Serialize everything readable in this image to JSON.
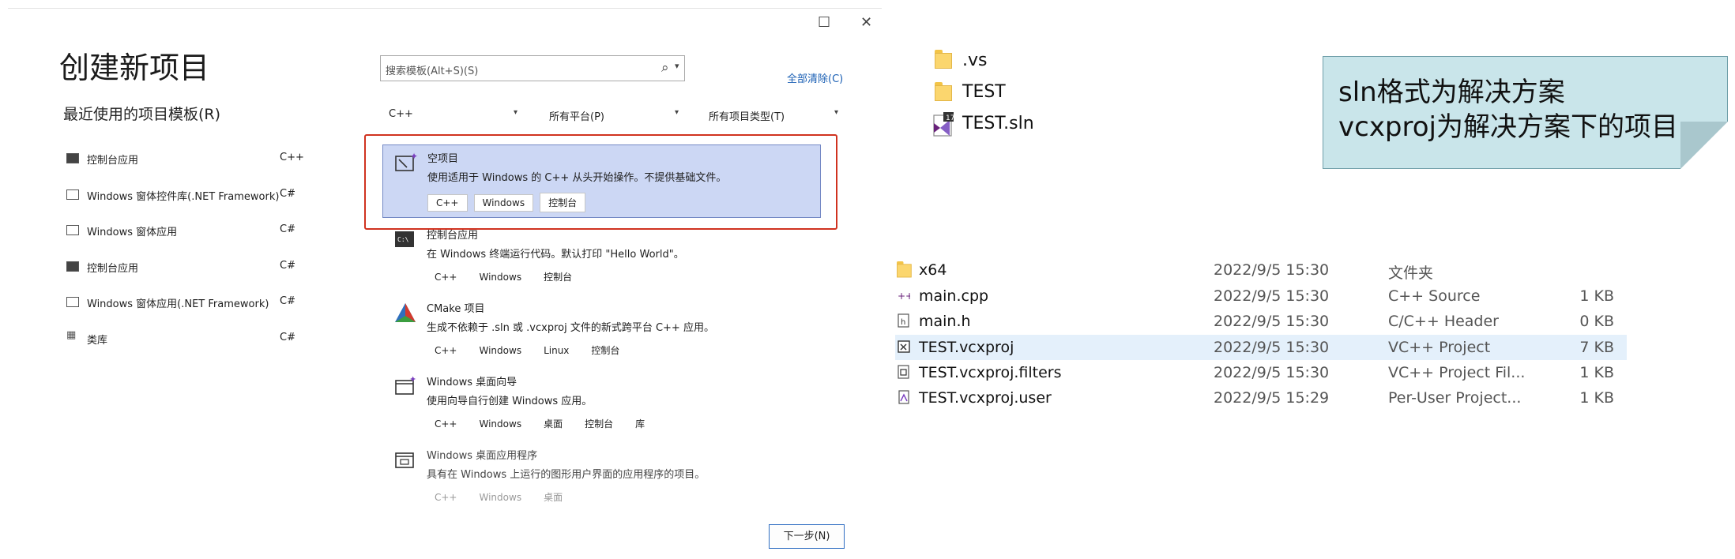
{
  "dialog": {
    "window_controls": {
      "maximize": "☐",
      "close": "✕"
    },
    "title": "创建新项目",
    "recent_heading": "最近使用的项目模板(R)",
    "recent_items": [
      {
        "label": "控制台应用",
        "lang": "C++",
        "icon": "console-icon"
      },
      {
        "label": "Windows 窗体控件库(.NET Framework)",
        "lang": "C#",
        "icon": "winforms-icon"
      },
      {
        "label": "Windows 窗体应用",
        "lang": "C#",
        "icon": "window-icon"
      },
      {
        "label": "控制台应用",
        "lang": "C#",
        "icon": "console-icon"
      },
      {
        "label": "Windows 窗体应用(.NET Framework)",
        "lang": "C#",
        "icon": "window-icon"
      },
      {
        "label": "类库",
        "lang": "C#",
        "icon": "library-icon"
      }
    ],
    "search": {
      "placeholder": "搜索模板(Alt+S)(S)"
    },
    "clear_all": "全部清除(C)",
    "filters": {
      "language": "C++",
      "platform": "所有平台(P)",
      "project_type": "所有项目类型(T)"
    },
    "templates": [
      {
        "name": "空项目",
        "desc": "使用适用于 Windows 的 C++ 从头开始操作。不提供基础文件。",
        "tags": [
          "C++",
          "Windows",
          "控制台"
        ],
        "selected": true
      },
      {
        "name": "控制台应用",
        "desc": "在 Windows 终端运行代码。默认打印 \"Hello World\"。",
        "tags": [
          "C++",
          "Windows",
          "控制台"
        ]
      },
      {
        "name": "CMake 项目",
        "desc": "生成不依赖于 .sln 或 .vcxproj 文件的新式跨平台 C++ 应用。",
        "tags": [
          "C++",
          "Windows",
          "Linux",
          "控制台"
        ]
      },
      {
        "name": "Windows 桌面向导",
        "desc": "使用向导自行创建 Windows 应用。",
        "tags": [
          "C++",
          "Windows",
          "桌面",
          "控制台",
          "库"
        ]
      },
      {
        "name": "Windows 桌面应用程序",
        "desc": "具有在 Windows 上运行的图形用户界面的应用程序的项目。",
        "tags": [
          "C++",
          "Windows",
          "桌面"
        ]
      }
    ],
    "next_button": "下一步(N)"
  },
  "solution_folder": [
    {
      "name": ".vs",
      "icon": "folder-icon"
    },
    {
      "name": "TEST",
      "icon": "folder-icon"
    },
    {
      "name": "TEST.sln",
      "icon": "sln-icon"
    }
  ],
  "callout": {
    "line1": "sln格式为解决方案",
    "line2": "vcxproj为解决方案下的项目"
  },
  "project_files": [
    {
      "name": "x64",
      "date": "2022/9/5 15:30",
      "type": "文件夹",
      "size": "",
      "icon": "folder-icon"
    },
    {
      "name": "main.cpp",
      "date": "2022/9/5 15:30",
      "type": "C++ Source",
      "size": "1 KB",
      "icon": "cpp-file-icon"
    },
    {
      "name": "main.h",
      "date": "2022/9/5 15:30",
      "type": "C/C++ Header",
      "size": "0 KB",
      "icon": "header-file-icon"
    },
    {
      "name": "TEST.vcxproj",
      "date": "2022/9/5 15:30",
      "type": "VC++ Project",
      "size": "7 KB",
      "icon": "vcxproj-icon",
      "selected": true
    },
    {
      "name": "TEST.vcxproj.filters",
      "date": "2022/9/5 15:30",
      "type": "VC++ Project Fil...",
      "size": "1 KB",
      "icon": "filters-file-icon"
    },
    {
      "name": "TEST.vcxproj.user",
      "date": "2022/9/5 15:29",
      "type": "Per-User Project...",
      "size": "1 KB",
      "icon": "user-file-icon"
    }
  ],
  "colors": {
    "selected_tile": "#ccd7f4",
    "highlight_box": "#d0321f",
    "callout_bg": "#c9e5ea",
    "selected_row": "#e4f0fb"
  }
}
